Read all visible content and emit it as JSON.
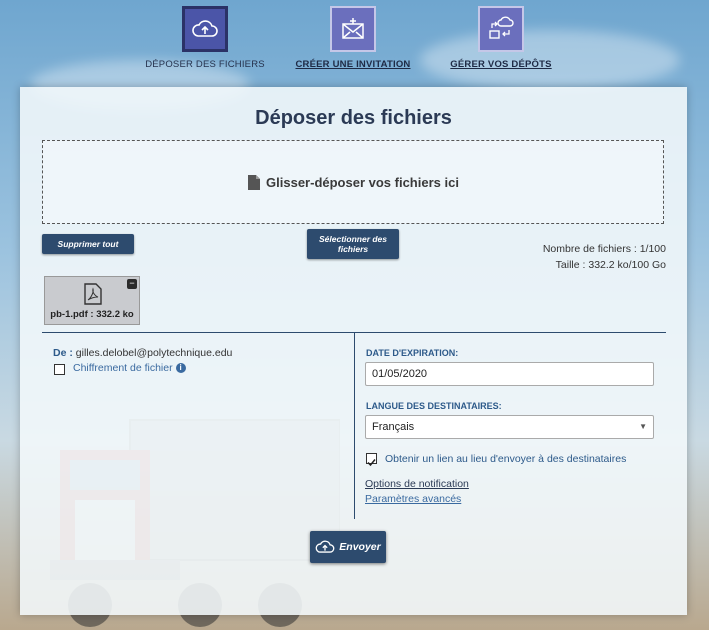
{
  "nav": {
    "items": [
      {
        "label": "DÉPOSER DES FICHIERS",
        "icon": "cloud-upload-icon",
        "active": true
      },
      {
        "label": "CRÉER UNE INVITATION",
        "icon": "envelope-plus-icon",
        "active": false
      },
      {
        "label": "GÉRER VOS DÉPÔTS",
        "icon": "transfer-icon",
        "active": false
      }
    ]
  },
  "main": {
    "title": "Déposer des fichiers",
    "dropzone_text": "Glisser-déposer vos fichiers ici",
    "clear_label": "Supprimer tout",
    "select_label": "Sélectionner des fichiers",
    "file_count": "Nombre de fichiers : 1/100",
    "size": "Taille : 332.2 ko/100 Go",
    "file": {
      "name": "pb-1.pdf : 332.2 ko",
      "remove": "−"
    }
  },
  "left": {
    "from_label": "De :",
    "from_value": "gilles.delobel@polytechnique.edu",
    "encrypt_label": "Chiffrement de fichier",
    "info": "i"
  },
  "right": {
    "expiry_label": "DATE D'EXPIRATION:",
    "expiry_value": "01/05/2020",
    "lang_label": "LANGUE DES DESTINATAIRES:",
    "lang_value": "Français",
    "obtain_link_label": "Obtenir un lien au lieu d'envoyer à des destinataires",
    "obtain_checked": true,
    "notif_label": "Options de notification",
    "advanced_label": "Paramètres avancés"
  },
  "send_label": "Envoyer",
  "colors": {
    "accent": "#2d4b6e",
    "nav_icon": "#6b6fbd",
    "link": "#2d5a8a"
  }
}
